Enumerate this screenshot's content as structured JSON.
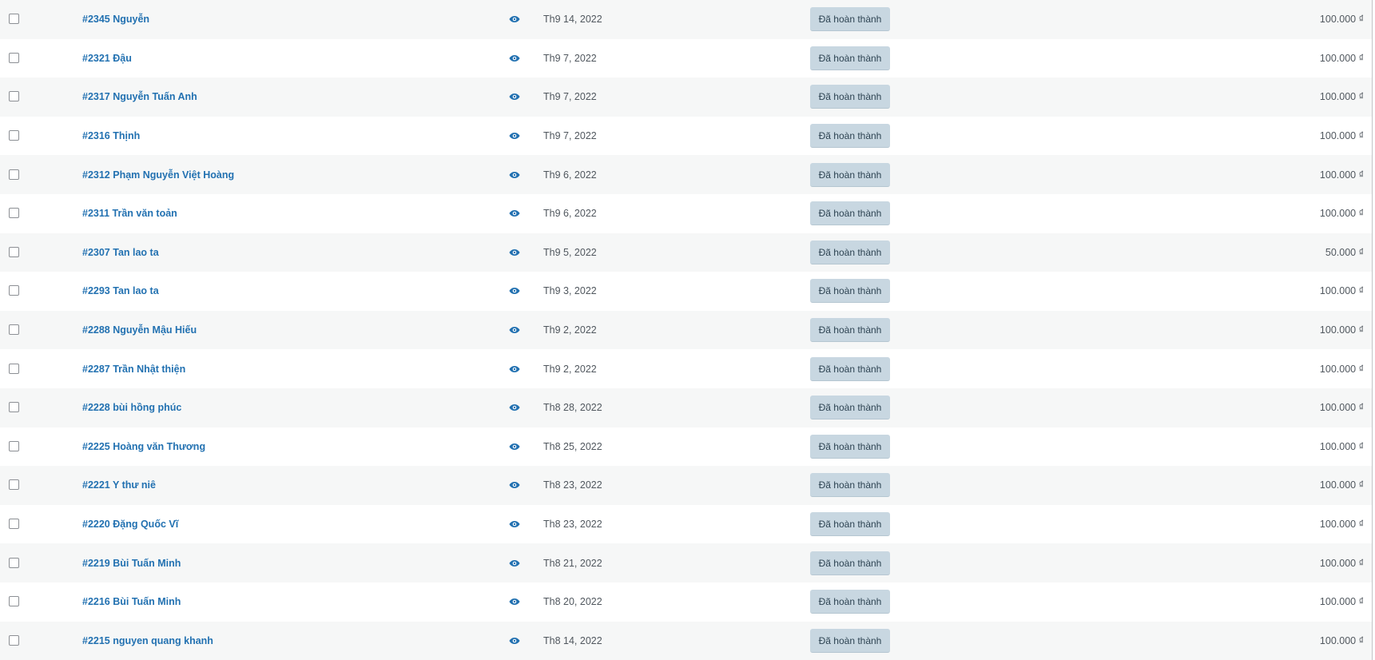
{
  "orders": [
    {
      "order": "#2345 Nguyễn",
      "date": "Th9 14, 2022",
      "status": "Đã hoàn thành",
      "total": "100.000 ₫"
    },
    {
      "order": "#2321 Đậu",
      "date": "Th9 7, 2022",
      "status": "Đã hoàn thành",
      "total": "100.000 ₫"
    },
    {
      "order": "#2317 Nguyễn Tuấn Anh",
      "date": "Th9 7, 2022",
      "status": "Đã hoàn thành",
      "total": "100.000 ₫"
    },
    {
      "order": "#2316 Thịnh",
      "date": "Th9 7, 2022",
      "status": "Đã hoàn thành",
      "total": "100.000 ₫"
    },
    {
      "order": "#2312 Phạm Nguyễn Việt Hoàng",
      "date": "Th9 6, 2022",
      "status": "Đã hoàn thành",
      "total": "100.000 ₫"
    },
    {
      "order": "#2311 Trần văn toản",
      "date": "Th9 6, 2022",
      "status": "Đã hoàn thành",
      "total": "100.000 ₫"
    },
    {
      "order": "#2307 Tan lao ta",
      "date": "Th9 5, 2022",
      "status": "Đã hoàn thành",
      "total": "50.000 ₫"
    },
    {
      "order": "#2293 Tan lao ta",
      "date": "Th9 3, 2022",
      "status": "Đã hoàn thành",
      "total": "100.000 ₫"
    },
    {
      "order": "#2288 Nguyễn Mậu Hiếu",
      "date": "Th9 2, 2022",
      "status": "Đã hoàn thành",
      "total": "100.000 ₫"
    },
    {
      "order": "#2287 Trần Nhật thiện",
      "date": "Th9 2, 2022",
      "status": "Đã hoàn thành",
      "total": "100.000 ₫"
    },
    {
      "order": "#2228 bùi hồng phúc",
      "date": "Th8 28, 2022",
      "status": "Đã hoàn thành",
      "total": "100.000 ₫"
    },
    {
      "order": "#2225 Hoàng văn Thương",
      "date": "Th8 25, 2022",
      "status": "Đã hoàn thành",
      "total": "100.000 ₫"
    },
    {
      "order": "#2221 Y thư niê",
      "date": "Th8 23, 2022",
      "status": "Đã hoàn thành",
      "total": "100.000 ₫"
    },
    {
      "order": "#2220 Đặng Quốc Vĩ",
      "date": "Th8 23, 2022",
      "status": "Đã hoàn thành",
      "total": "100.000 ₫"
    },
    {
      "order": "#2219 Bùi Tuấn Minh",
      "date": "Th8 21, 2022",
      "status": "Đã hoàn thành",
      "total": "100.000 ₫"
    },
    {
      "order": "#2216 Bùi Tuấn Minh",
      "date": "Th8 20, 2022",
      "status": "Đã hoàn thành",
      "total": "100.000 ₫"
    },
    {
      "order": "#2215 nguyen quang khanh",
      "date": "Th8 14, 2022",
      "status": "Đã hoàn thành",
      "total": "100.000 ₫"
    }
  ],
  "colors": {
    "link": "#2271b1",
    "status_bg": "#c8d7e1",
    "status_text": "#2e4453",
    "row_alt": "#f6f7f7"
  },
  "icons": {
    "preview": "eye-icon"
  }
}
